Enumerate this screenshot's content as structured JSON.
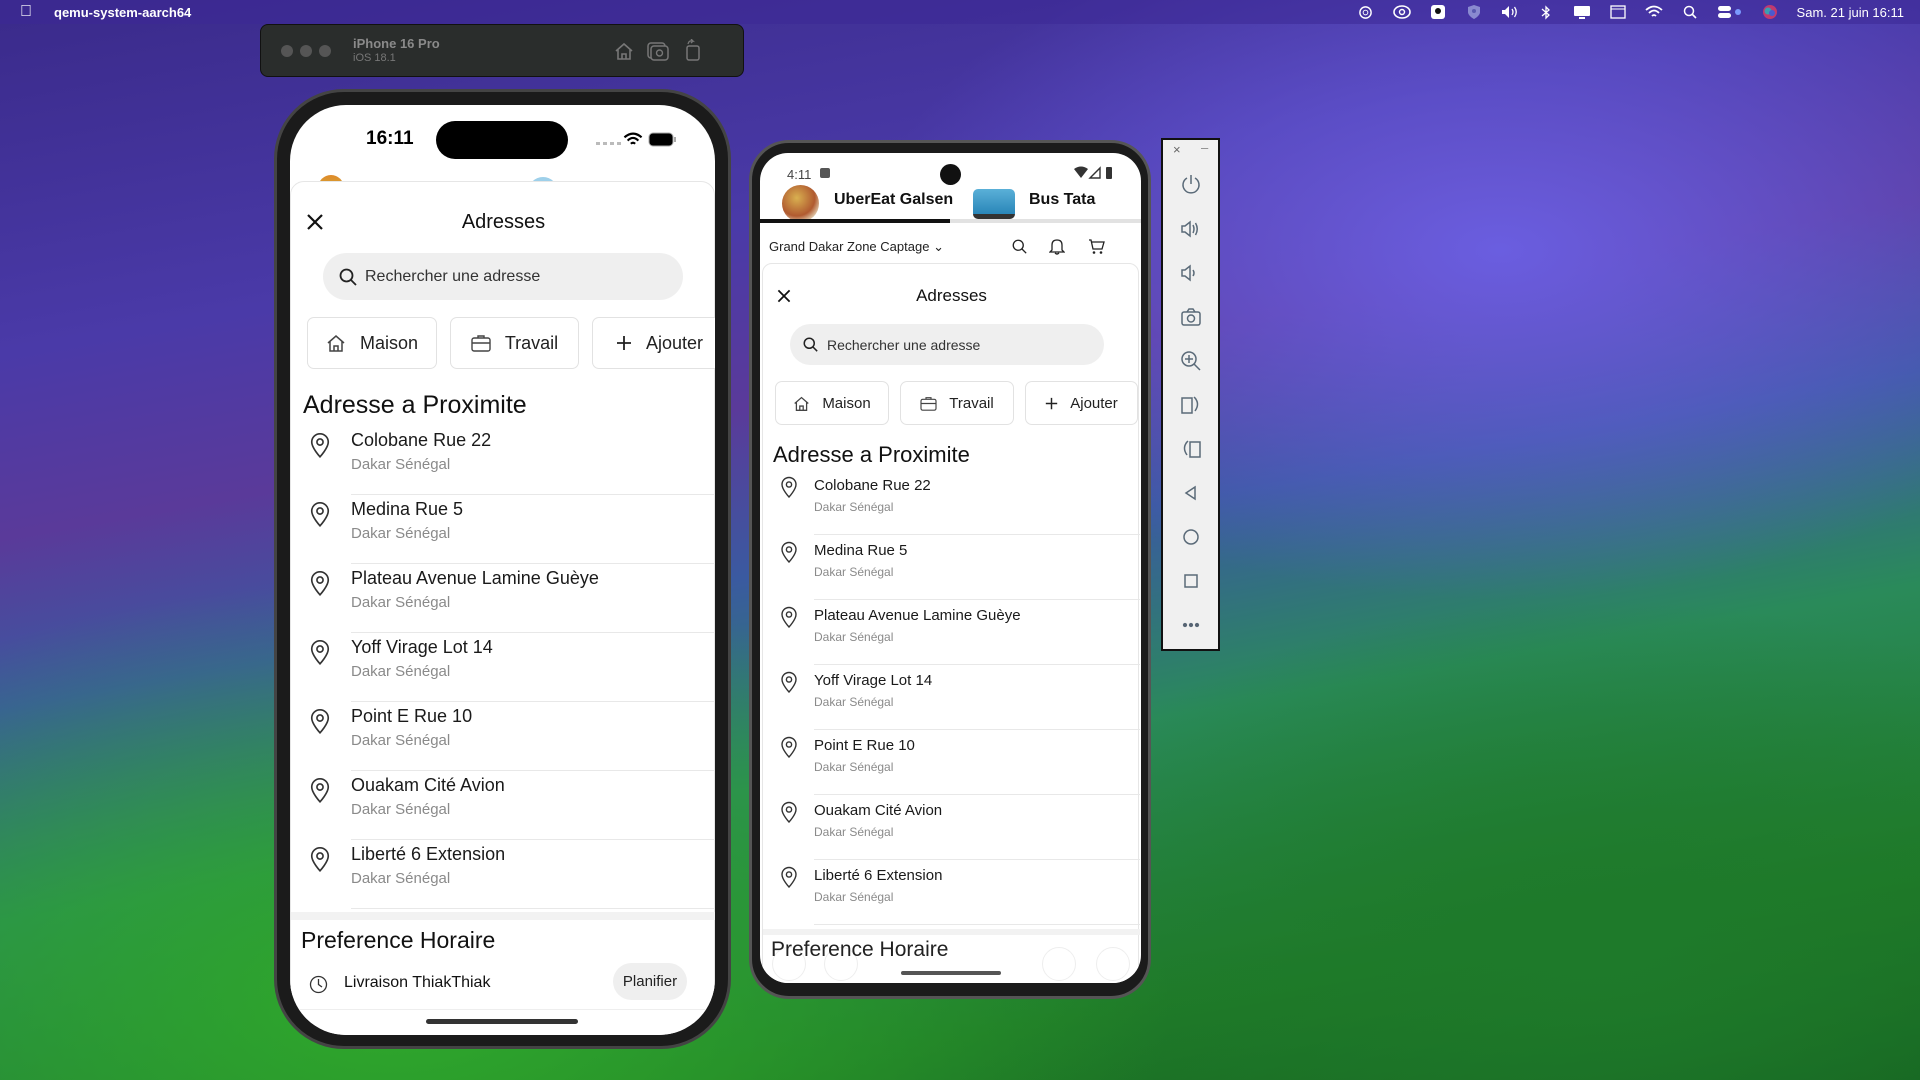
{
  "menubar": {
    "app_name": "qemu-system-aarch64",
    "clock": "Sam. 21 juin 16:11",
    "icons": [
      "openai-icon",
      "creative-cloud-icon",
      "gear-download-icon",
      "vpn-shield-icon",
      "volume-icon",
      "bluetooth-icon",
      "display-icon",
      "window-icon",
      "wifi-icon",
      "spotlight-search-icon",
      "control-center-icon",
      "siri-icon"
    ]
  },
  "simulator_toolbar": {
    "device_name": "iPhone 16 Pro",
    "os_version": "iOS 18.1",
    "icons": [
      "home-icon",
      "screenshot-icon",
      "rotate-icon"
    ]
  },
  "iphone": {
    "status_time": "16:11",
    "sheet_title": "Adresses",
    "search_placeholder": "Rechercher une adresse",
    "chips": [
      {
        "label": "Maison",
        "icon": "home-icon"
      },
      {
        "label": "Travail",
        "icon": "briefcase-icon"
      },
      {
        "label": "Ajouter",
        "icon": "plus-icon"
      }
    ],
    "section_title": "Adresse a Proximite",
    "addresses": [
      {
        "name": "Colobane Rue 22",
        "city": "Dakar Sénégal"
      },
      {
        "name": "Medina Rue 5",
        "city": "Dakar Sénégal"
      },
      {
        "name": "Plateau Avenue Lamine Guèye",
        "city": "Dakar Sénégal"
      },
      {
        "name": "Yoff Virage Lot 14",
        "city": "Dakar Sénégal"
      },
      {
        "name": "Point E Rue 10",
        "city": "Dakar Sénégal"
      },
      {
        "name": "Ouakam Cité Avion",
        "city": "Dakar Sénégal"
      },
      {
        "name": "Liberté 6 Extension",
        "city": "Dakar Sénégal"
      }
    ],
    "preference_title": "Preference Horaire",
    "delivery_label": "Livraison ThiakThiak",
    "schedule_button": "Planifier"
  },
  "android": {
    "status_time": "4:11",
    "tabs": [
      {
        "label": "UberEat Galsen",
        "active": true
      },
      {
        "label": "Bus Tata",
        "active": false
      }
    ],
    "location": "Grand Dakar Zone Captage",
    "sheet_title": "Adresses",
    "search_placeholder": "Rechercher une adresse",
    "chips": [
      {
        "label": "Maison"
      },
      {
        "label": "Travail"
      },
      {
        "label": "Ajouter"
      }
    ],
    "section_title": "Adresse a Proximite",
    "addresses": [
      {
        "name": "Colobane Rue 22",
        "city": "Dakar Sénégal"
      },
      {
        "name": "Medina Rue 5",
        "city": "Dakar Sénégal"
      },
      {
        "name": "Plateau Avenue Lamine Guèye",
        "city": "Dakar Sénégal"
      },
      {
        "name": "Yoff Virage Lot 14",
        "city": "Dakar Sénégal"
      },
      {
        "name": "Point E Rue 10",
        "city": "Dakar Sénégal"
      },
      {
        "name": "Ouakam Cité Avion",
        "city": "Dakar Sénégal"
      },
      {
        "name": "Liberté 6 Extension",
        "city": "Dakar Sénégal"
      }
    ],
    "preference_title": "Preference Horaire"
  },
  "emulator_panel": {
    "buttons": [
      "power",
      "volume-up",
      "volume-down",
      "camera",
      "zoom",
      "rotate-left",
      "rotate-right",
      "back",
      "home",
      "overview",
      "more"
    ]
  }
}
